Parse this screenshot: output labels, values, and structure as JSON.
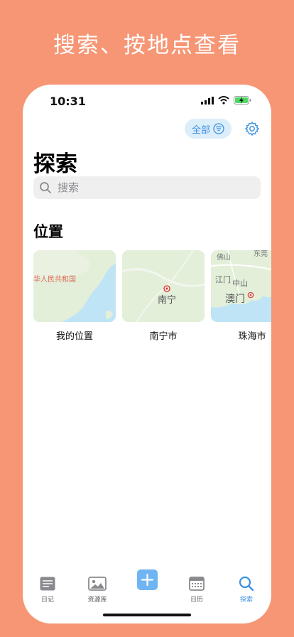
{
  "promo": {
    "headline": "搜索、按地点查看"
  },
  "status_bar": {
    "time": "10:31"
  },
  "header": {
    "filter_label": "全部",
    "title": "探索"
  },
  "search": {
    "placeholder": "搜索"
  },
  "locations": {
    "section_title": "位置",
    "cards": [
      {
        "caption": "我的位置",
        "map_label": "华人民共和国"
      },
      {
        "caption": "南宁市",
        "map_label": "南宁"
      },
      {
        "caption": "珠海市",
        "map_label": "澳门",
        "map_labels_minor": [
          "佛山",
          "江门",
          "中山",
          "东莞"
        ]
      }
    ]
  },
  "tabbar": {
    "items": [
      {
        "label": "日记",
        "icon": "journal-icon"
      },
      {
        "label": "资源库",
        "icon": "photo-library-icon"
      },
      {
        "label": "",
        "icon": "add-icon"
      },
      {
        "label": "日历",
        "icon": "calendar-icon"
      },
      {
        "label": "探索",
        "icon": "search-icon",
        "active": true
      }
    ]
  },
  "colors": {
    "background": "#F69675",
    "accent": "#3C8FE0",
    "filter_bg": "#DDEEFB"
  }
}
